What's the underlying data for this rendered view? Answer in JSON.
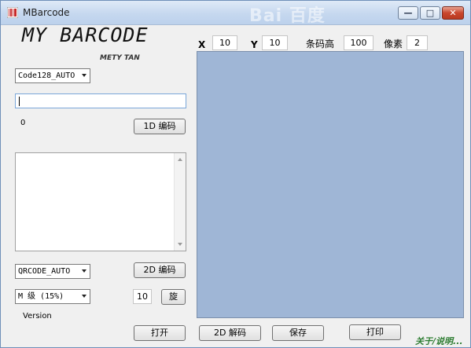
{
  "window": {
    "title": "MBarcode",
    "watermark": "Bai 百度",
    "controls": {
      "minimize": "—",
      "maximize": "□",
      "close": "✕"
    }
  },
  "logo": {
    "title": "MY BARCODE",
    "author": "METY TAN"
  },
  "params": {
    "x_label": "X",
    "x_value": "10",
    "y_label": "Y",
    "y_value": "10",
    "height_label": "条码高",
    "height_value": "100",
    "pixel_label": "像素",
    "pixel_value": "2"
  },
  "left": {
    "code1d_select": "Code128_AUTO",
    "text_input_value": "",
    "char_count": "0",
    "encode1d_button": "1D 编码",
    "textarea_value": "",
    "qr_select": "QRCODE_AUTO",
    "encode2d_button": "2D 编码",
    "ec_level_select": "M 级 (15%)",
    "rotate_value": "10",
    "rotate_button": "旋",
    "version_label": "Version"
  },
  "bottom": {
    "open_button": "打开",
    "decode2d_button": "2D 解码",
    "save_button": "保存",
    "print_button": "打印",
    "about_link": "关于/说明..."
  },
  "colors": {
    "canvas": "#9fb6d6",
    "about_link": "#2e7d32"
  }
}
